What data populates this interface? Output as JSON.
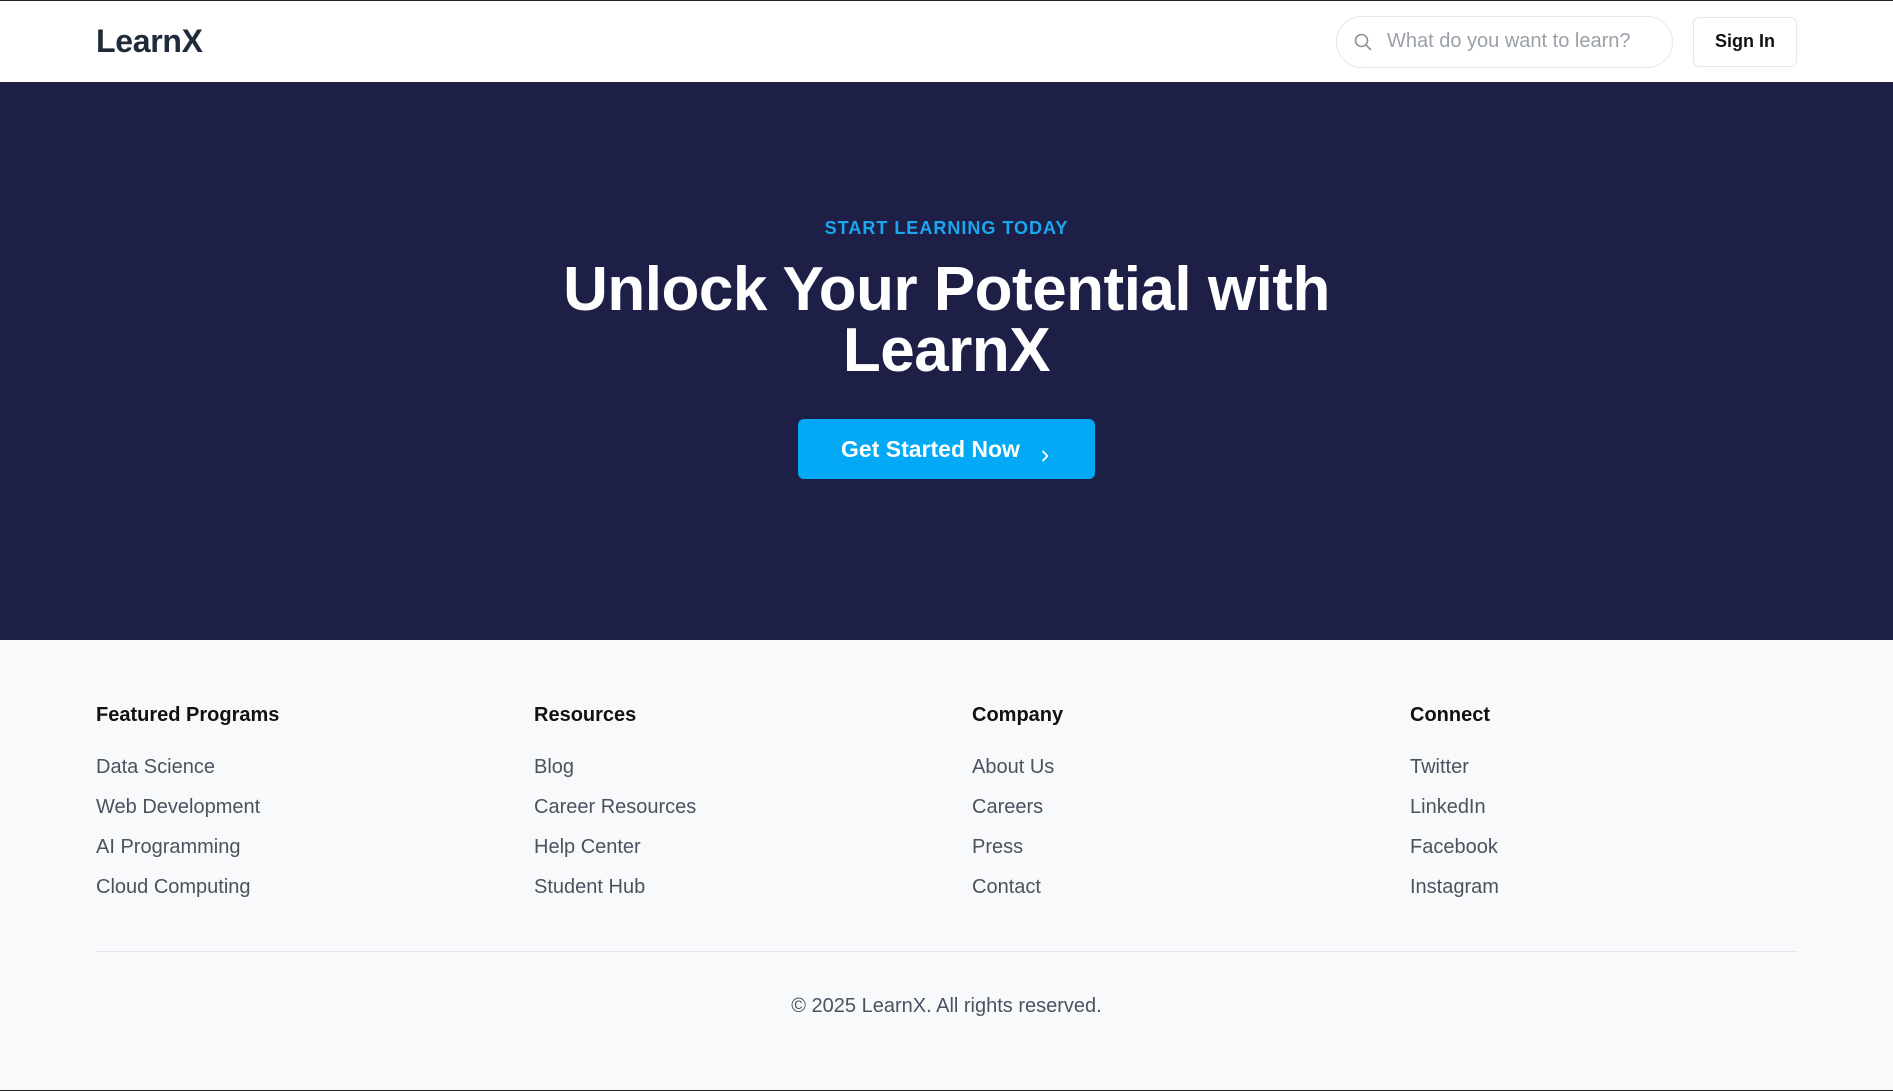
{
  "header": {
    "logo": "LearnX",
    "search_placeholder": "What do you want to learn?",
    "signin_label": "Sign In"
  },
  "hero": {
    "eyebrow": "START LEARNING TODAY",
    "title": "Unlock Your Potential with LearnX",
    "cta_label": "Get Started Now"
  },
  "footer": {
    "columns": [
      {
        "heading": "Featured Programs",
        "links": [
          "Data Science",
          "Web Development",
          "AI Programming",
          "Cloud Computing"
        ]
      },
      {
        "heading": "Resources",
        "links": [
          "Blog",
          "Career Resources",
          "Help Center",
          "Student Hub"
        ]
      },
      {
        "heading": "Company",
        "links": [
          "About Us",
          "Careers",
          "Press",
          "Contact"
        ]
      },
      {
        "heading": "Connect",
        "links": [
          "Twitter",
          "LinkedIn",
          "Facebook",
          "Instagram"
        ]
      }
    ],
    "copyright": "© 2025 LearnX. All rights reserved."
  },
  "icons": {
    "search": "search-icon",
    "chevron": "chevron-right-icon"
  },
  "colors": {
    "hero_bg": "#1d1f47",
    "accent": "#03a9f4",
    "eyebrow": "#1aa7f0",
    "footer_bg": "#f8f9fb"
  }
}
